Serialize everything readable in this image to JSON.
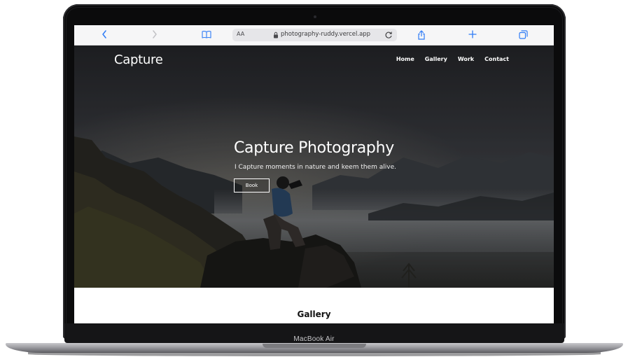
{
  "device": {
    "model_label": "MacBook Air"
  },
  "browser": {
    "text_size_label": "AA",
    "url": "photography-ruddy.vercel.app",
    "icons": {
      "back": "chevron-left-icon",
      "forward": "chevron-right-icon",
      "bookmarks": "book-icon",
      "secure": "lock-icon",
      "reload": "reload-icon",
      "share": "share-icon",
      "new_tab": "plus-icon",
      "tabs": "tabs-icon"
    },
    "accent_color": "#2f7cf6"
  },
  "site": {
    "logo": "Capture",
    "nav": [
      {
        "label": "Home"
      },
      {
        "label": "Gallery"
      },
      {
        "label": "Work"
      },
      {
        "label": "Contact"
      }
    ],
    "hero": {
      "title": "Capture Photography",
      "subtitle": "I Capture moments in nature and keem them alive.",
      "button_label": "Book"
    },
    "gallery": {
      "heading": "Gallery"
    }
  }
}
